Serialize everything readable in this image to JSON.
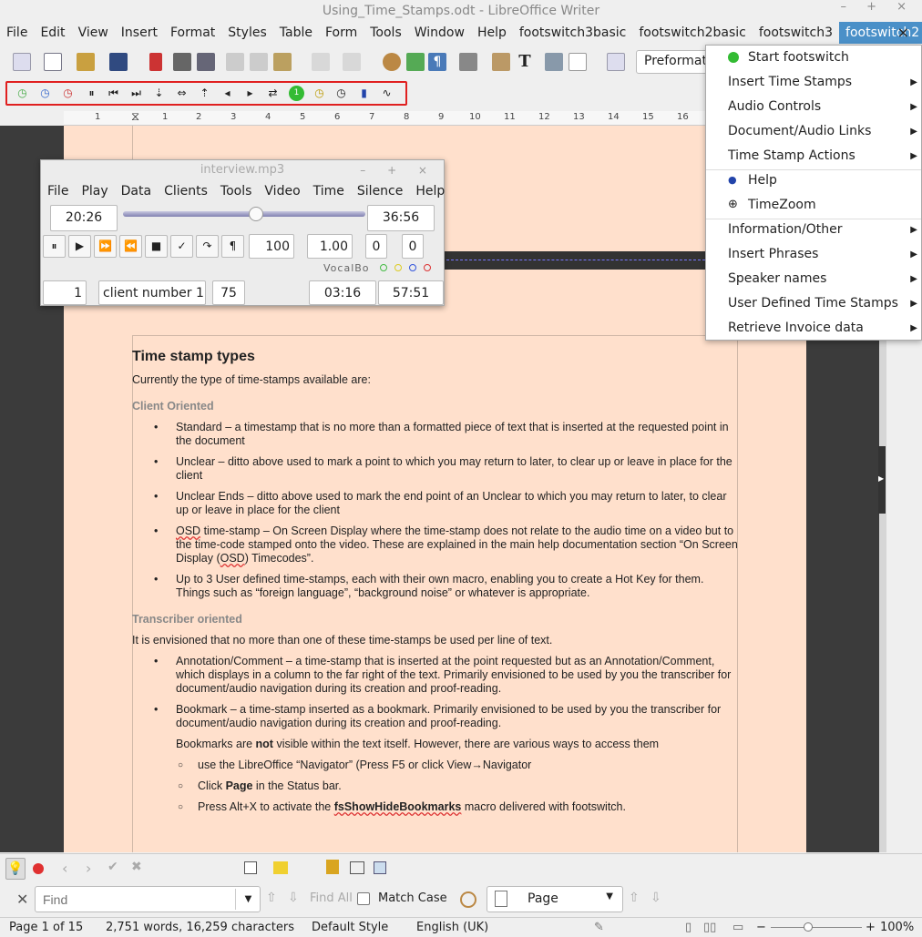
{
  "window": {
    "title": "Using_Time_Stamps.odt - LibreOffice Writer",
    "controls": "– + ×"
  },
  "menu": [
    "File",
    "Edit",
    "View",
    "Insert",
    "Format",
    "Styles",
    "Table",
    "Form",
    "Tools",
    "Window",
    "Help",
    "footswitch3basic",
    "footswitch2basic",
    "footswitch3",
    "footswitch2"
  ],
  "menu_close": "×",
  "toolbar": {
    "paragraph_style": "Preformatt"
  },
  "ruler": [
    "1",
    "1",
    "1",
    "2",
    "3",
    "4",
    "5",
    "6",
    "7",
    "8",
    "9",
    "10",
    "11",
    "12",
    "13",
    "14",
    "15",
    "16"
  ],
  "player": {
    "title": "interview.mp3",
    "controls": "– + ×",
    "menu": [
      "File",
      "Play",
      "Data",
      "Clients",
      "Tools",
      "Video",
      "Time",
      "Silence",
      "Help"
    ],
    "current_time": "20:26",
    "total_time": "36:56",
    "position_fraction": 0.55,
    "buttons": [
      "⏸",
      "▶",
      "⏩",
      "⏪",
      "■",
      "✓",
      "↷",
      "¶"
    ],
    "volume": "100",
    "speed": "1.00",
    "val_a": "0",
    "val_b": "0",
    "vocal_label": "VocalBo",
    "client_num": "1",
    "client_name": "client number 1",
    "client_rate": "75",
    "time_a": "03:16",
    "time_b": "57:51",
    "dot_colors": [
      "#44bb44",
      "#ddcc22",
      "#3355dd",
      "#dd3333"
    ]
  },
  "dropdown": [
    {
      "label": "Start footswitch",
      "submenu": false,
      "icon": "green-circle-icon"
    },
    {
      "label": "Insert Time Stamps",
      "submenu": true
    },
    {
      "label": "Audio Controls",
      "submenu": true
    },
    {
      "label": "Document/Audio Links",
      "submenu": true
    },
    {
      "label": "Time Stamp Actions",
      "submenu": true
    },
    {
      "label": "Help",
      "submenu": false,
      "icon": "help-icon"
    },
    {
      "label": "TimeZoom",
      "submenu": false,
      "icon": "zoom-icon"
    },
    {
      "label": "Information/Other",
      "submenu": true
    },
    {
      "label": "Insert Phrases",
      "submenu": true
    },
    {
      "label": "Speaker names",
      "submenu": true
    },
    {
      "label": "User Defined Time Stamps",
      "submenu": true
    },
    {
      "label": "Retrieve Invoice data",
      "submenu": true
    }
  ],
  "doc": {
    "h1": "Time stamp types",
    "intro": "Currently the type of time-stamps available are:",
    "h2a": "Client Oriented",
    "client_items": [
      "Standard – a timestamp that is no more than a formatted piece of text that is inserted at the requested point in the document",
      "Unclear – ditto above used to mark a point to which you may return to later, to clear up or leave in place for the client",
      "Unclear Ends – ditto above  used to mark the end point of an Unclear to which you may return to later, to clear up or leave in place for the client",
      "Up to 3 User defined time-stamps, each with their own macro, enabling you to create a Hot Key for them. Things such as “foreign language”, “background noise” or whatever is appropriate."
    ],
    "osd_a": "OSD",
    "osd_b": " time-stamp – On Screen Display where the time-stamp does not relate to the audio time on a video but to the time-code stamped onto the video. These are explained in the main help documentation section “On Screen Display (",
    "osd_c": "OSD",
    "osd_d": ") Timecodes”.",
    "h2b": "Transcriber oriented",
    "trans_intro": "It is envisioned that no more than one of these time-stamps be used per line of text.",
    "trans_items": [
      "Annotation/Comment – a time-stamp that is inserted at the point requested but as an Annotation/Comment, which displays in a column to the far right of the text. Primarily envisioned to be used by you the transcriber for document/audio navigation during its creation and proof-reading.",
      "Bookmark – a time-stamp inserted as a bookmark. Primarily envisioned to be used by you the transcriber for document/audio navigation during its creation and proof-reading."
    ],
    "bm_a": "Bookmarks are ",
    "bm_b": "not",
    "bm_c": " visible within the text itself. However, there are various ways to access them",
    "sub1": "use the LibreOffice “Navigator” (Press F5 or click View→Navigator",
    "sub2a": "Click ",
    "sub2b": "Page",
    "sub2c": " in the Status bar.",
    "sub3a": "Press Alt+X to activate the ",
    "sub3b": "fsShowHideBookmarks",
    "sub3c": " macro delivered with footswitch."
  },
  "find": {
    "placeholder": "Find",
    "find_all": "Find All",
    "match_case": "Match Case",
    "nav_target": "Page"
  },
  "status": {
    "page": "Page 1 of 15",
    "words": "2,751 words, 16,259 characters",
    "style": "Default Style",
    "lang": "English (UK)",
    "zoom": "100%"
  }
}
